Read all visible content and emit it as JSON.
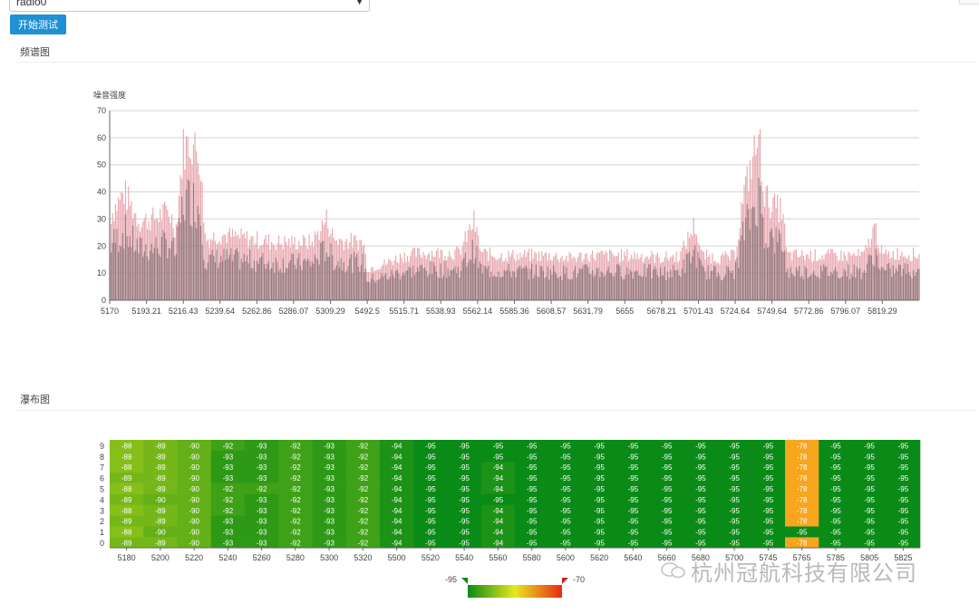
{
  "radio_select": {
    "value": "radio0"
  },
  "start_button": {
    "label": "开始测试"
  },
  "sections": {
    "spectrum": "频谱图",
    "waterfall": "瀑布图"
  },
  "chart_data": [
    {
      "type": "area",
      "ylabel": "噪音强度",
      "ylim": [
        0,
        70
      ],
      "yticks": [
        0,
        10,
        20,
        30,
        40,
        50,
        60,
        70
      ],
      "grid": true,
      "x_tick_labels": [
        "5170",
        "5193.21",
        "5216.43",
        "5239.64",
        "5262.86",
        "5286.07",
        "5309.29",
        "5492.5",
        "5515.71",
        "5538.93",
        "5562.14",
        "5585.36",
        "5608.57",
        "5631.79",
        "5655",
        "5678.21",
        "5701.43",
        "5724.64",
        "5749.64",
        "5772.86",
        "5796.07",
        "5819.29"
      ],
      "envelope": [
        {
          "x": 0,
          "y": 32
        },
        {
          "x": 0.4,
          "y": 41
        },
        {
          "x": 0.8,
          "y": 30
        },
        {
          "x": 1.2,
          "y": 31
        },
        {
          "x": 1.6,
          "y": 34
        },
        {
          "x": 1.8,
          "y": 27
        },
        {
          "x": 2.0,
          "y": 58
        },
        {
          "x": 2.2,
          "y": 60
        },
        {
          "x": 2.45,
          "y": 55
        },
        {
          "x": 2.6,
          "y": 23
        },
        {
          "x": 3.0,
          "y": 25
        },
        {
          "x": 3.5,
          "y": 24
        },
        {
          "x": 4.0,
          "y": 23
        },
        {
          "x": 4.5,
          "y": 22
        },
        {
          "x": 5.0,
          "y": 22
        },
        {
          "x": 5.5,
          "y": 22
        },
        {
          "x": 5.9,
          "y": 31
        },
        {
          "x": 6.1,
          "y": 23
        },
        {
          "x": 6.9,
          "y": 22
        },
        {
          "x": 7.0,
          "y": 12
        },
        {
          "x": 7.5,
          "y": 14
        },
        {
          "x": 8.0,
          "y": 17
        },
        {
          "x": 8.5,
          "y": 18
        },
        {
          "x": 9.0,
          "y": 18
        },
        {
          "x": 9.5,
          "y": 18
        },
        {
          "x": 9.9,
          "y": 30
        },
        {
          "x": 10.1,
          "y": 18
        },
        {
          "x": 10.5,
          "y": 17
        },
        {
          "x": 11.0,
          "y": 17
        },
        {
          "x": 11.5,
          "y": 17
        },
        {
          "x": 12.0,
          "y": 17
        },
        {
          "x": 12.5,
          "y": 16
        },
        {
          "x": 13.0,
          "y": 17
        },
        {
          "x": 13.5,
          "y": 17
        },
        {
          "x": 14.0,
          "y": 17
        },
        {
          "x": 14.5,
          "y": 17
        },
        {
          "x": 15.0,
          "y": 16
        },
        {
          "x": 15.5,
          "y": 17
        },
        {
          "x": 15.9,
          "y": 29
        },
        {
          "x": 16.1,
          "y": 17
        },
        {
          "x": 16.6,
          "y": 16
        },
        {
          "x": 17.0,
          "y": 17
        },
        {
          "x": 17.2,
          "y": 38
        },
        {
          "x": 17.5,
          "y": 55
        },
        {
          "x": 17.65,
          "y": 62
        },
        {
          "x": 17.8,
          "y": 40
        },
        {
          "x": 18.0,
          "y": 36
        },
        {
          "x": 18.3,
          "y": 34
        },
        {
          "x": 18.4,
          "y": 17
        },
        {
          "x": 19.0,
          "y": 17
        },
        {
          "x": 19.5,
          "y": 17
        },
        {
          "x": 20.0,
          "y": 17
        },
        {
          "x": 20.5,
          "y": 17
        },
        {
          "x": 20.8,
          "y": 28
        },
        {
          "x": 21.0,
          "y": 17
        },
        {
          "x": 21.5,
          "y": 18
        },
        {
          "x": 22.0,
          "y": 17
        }
      ]
    },
    {
      "type": "heatmap",
      "x": [
        "5180",
        "5200",
        "5220",
        "5240",
        "5260",
        "5280",
        "5300",
        "5320",
        "5500",
        "5520",
        "5540",
        "5560",
        "5580",
        "5600",
        "5620",
        "5640",
        "5660",
        "5680",
        "5700",
        "5745",
        "5765",
        "5785",
        "5805",
        "5825"
      ],
      "y": [
        "0",
        "1",
        "2",
        "3",
        "4",
        "5",
        "6",
        "7",
        "8",
        "9"
      ],
      "rows": [
        [
          -89,
          -89,
          -90,
          -93,
          -93,
          -92,
          -93,
          -92,
          -94,
          -95,
          -95,
          -94,
          -95,
          -95,
          -95,
          -95,
          -95,
          -95,
          -95,
          -95,
          -78,
          -95,
          -95,
          -95
        ],
        [
          -88,
          -90,
          -90,
          -93,
          -93,
          -92,
          -93,
          -92,
          -94,
          -95,
          -95,
          -94,
          -95,
          -95,
          -95,
          -95,
          -95,
          -95,
          -95,
          -95,
          -95,
          -95,
          -95,
          -95
        ],
        [
          -89,
          -89,
          -90,
          -93,
          -93,
          -92,
          -93,
          -92,
          -94,
          -95,
          -95,
          -94,
          -95,
          -95,
          -95,
          -95,
          -95,
          -95,
          -95,
          -95,
          -78,
          -95,
          -95,
          -95
        ],
        [
          -88,
          -89,
          -90,
          -92,
          -93,
          -92,
          -93,
          -92,
          -94,
          -95,
          -95,
          -94,
          -95,
          -95,
          -95,
          -95,
          -95,
          -95,
          -95,
          -95,
          -78,
          -95,
          -95,
          -95
        ],
        [
          -89,
          -90,
          -90,
          -92,
          -93,
          -92,
          -93,
          -92,
          -94,
          -95,
          -95,
          -95,
          -95,
          -95,
          -95,
          -95,
          -95,
          -95,
          -95,
          -95,
          -78,
          -95,
          -95,
          -95
        ],
        [
          -88,
          -89,
          -90,
          -92,
          -92,
          -92,
          -93,
          -92,
          -94,
          -95,
          -95,
          -94,
          -95,
          -95,
          -95,
          -95,
          -95,
          -95,
          -95,
          -95,
          -78,
          -95,
          -95,
          -95
        ],
        [
          -89,
          -89,
          -90,
          -93,
          -93,
          -92,
          -93,
          -92,
          -94,
          -95,
          -95,
          -94,
          -95,
          -95,
          -95,
          -95,
          -95,
          -95,
          -95,
          -95,
          -78,
          -95,
          -95,
          -95
        ],
        [
          -88,
          -89,
          -90,
          -93,
          -93,
          -92,
          -93,
          -92,
          -94,
          -95,
          -95,
          -94,
          -95,
          -95,
          -95,
          -95,
          -95,
          -95,
          -95,
          -95,
          -78,
          -95,
          -95,
          -95
        ],
        [
          -88,
          -89,
          -90,
          -93,
          -93,
          -92,
          -93,
          -92,
          -94,
          -95,
          -95,
          -95,
          -95,
          -95,
          -95,
          -95,
          -95,
          -95,
          -95,
          -95,
          -78,
          -95,
          -95,
          -95
        ],
        [
          -88,
          -89,
          -90,
          -92,
          -93,
          -92,
          -93,
          -92,
          -94,
          -95,
          -95,
          -95,
          -95,
          -95,
          -95,
          -95,
          -95,
          -95,
          -95,
          -95,
          -78,
          -95,
          -95,
          -95
        ]
      ],
      "scale": {
        "min": -95,
        "max": -70,
        "min_label": "-95",
        "max_label": "-70"
      },
      "colors": {
        "low": "#0a8a16",
        "mid": "#e8e81c",
        "high": "#e82a16",
        "highlight": "#f7a61d"
      }
    }
  ],
  "colors": {
    "button": "#1e90d6",
    "spectrum_fill": "#e8aab0",
    "spectrum_dark": "#8a6f73",
    "grid": "#d4d4d4"
  },
  "watermark": {
    "text": "杭州冠航科技有限公司"
  }
}
